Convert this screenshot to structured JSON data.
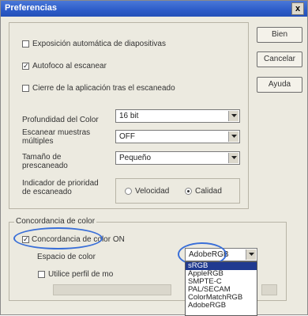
{
  "window": {
    "title": "Preferencias",
    "close_label": "x"
  },
  "buttons": {
    "ok": "Bien",
    "cancel": "Cancelar",
    "help": "Ayuda"
  },
  "options": {
    "auto_exposure": "Exposición automática de diapositivas",
    "autofocus": "Autofoco al escanear",
    "close_app": "Cierre de la aplicación tras el escaneado"
  },
  "fields": {
    "color_depth": {
      "label": "Profundidad del Color",
      "value": "16 bit"
    },
    "multi_sample": {
      "label_line1": "Escanear muestras",
      "label_line2": "múltiples",
      "value": "OFF"
    },
    "preview_size": {
      "label_line1": "Tamaño de",
      "label_line2": "prescaneado",
      "value": "Pequeño"
    },
    "priority": {
      "label_line1": "Indicador de prioridad",
      "label_line2": "de escaneado",
      "opt_speed": "Velocidad",
      "opt_quality": "Calidad"
    }
  },
  "color_matching": {
    "group_label": "Concordancia de color",
    "cm_on": "Concordancia de color ON",
    "space_label": "Espacio de color",
    "space_value": "AdobeRGB",
    "profile_label": "Utilice perfil de mo",
    "dropdown_items": [
      "sRGB",
      "AppleRGB",
      "SMPTE-C",
      "PAL/SECAM",
      "ColorMatchRGB",
      "AdobeRGB"
    ]
  }
}
